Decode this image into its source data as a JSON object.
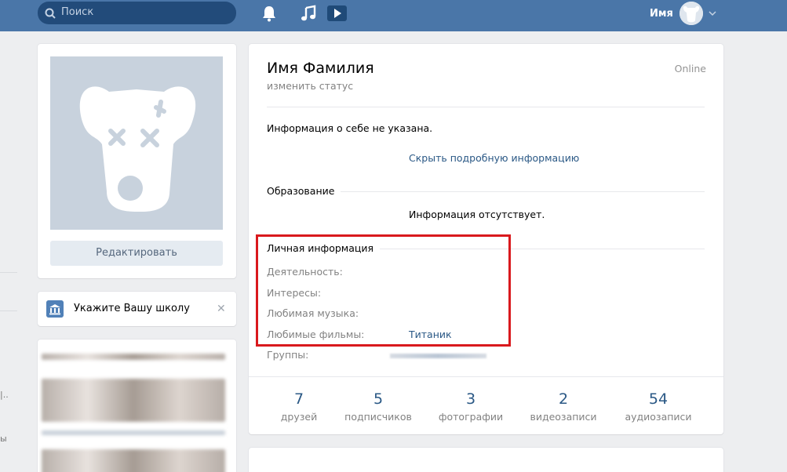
{
  "header": {
    "search_placeholder": "Поиск",
    "user_name": "Имя"
  },
  "left": {
    "edit_button": "Редактировать",
    "school_prompt": "Укажите Вашу школу",
    "school_close": "✕"
  },
  "profile": {
    "name": "Имя Фамилия",
    "status_action": "изменить статус",
    "online": "Online",
    "about": "Информация о себе не указана.",
    "hide_details": "Скрыть подробную информацию",
    "education_title": "Образование",
    "education_value": "Информация отсутствует.",
    "personal_title": "Личная информация",
    "fields": [
      {
        "label": "Деятельность:",
        "value": ""
      },
      {
        "label": "Интересы:",
        "value": ""
      },
      {
        "label": "Любимая музыка:",
        "value": ""
      },
      {
        "label": "Любимые фильмы:",
        "value": "Титаник"
      },
      {
        "label": "Группы:",
        "value": ""
      }
    ]
  },
  "counters": [
    {
      "value": "7",
      "label": "друзей"
    },
    {
      "value": "5",
      "label": "подписчиков"
    },
    {
      "value": "3",
      "label": "фотографии"
    },
    {
      "value": "2",
      "label": "видеозаписи"
    },
    {
      "value": "54",
      "label": "аудиозаписи"
    }
  ],
  "edge_fragments": {
    "a": "|..",
    "b": "ы"
  },
  "colors": {
    "header": "#4a76a8",
    "link": "#2a5885",
    "highlight": "#d9191d"
  }
}
